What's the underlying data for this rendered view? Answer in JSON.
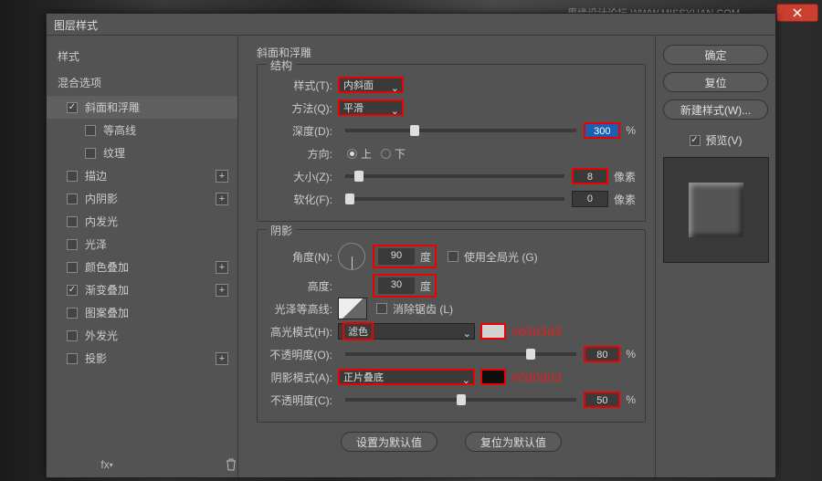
{
  "watermark": "思缘设计论坛  WWW.MISSYUAN.COM",
  "dialog_title": "图层样式",
  "sidebar": {
    "head1": "样式",
    "head2": "混合选项",
    "items": [
      {
        "label": "斜面和浮雕",
        "checked": true,
        "selected": true,
        "plus": false,
        "child": false
      },
      {
        "label": "等高线",
        "checked": false,
        "plus": false,
        "child": true
      },
      {
        "label": "纹理",
        "checked": false,
        "plus": false,
        "child": true
      },
      {
        "label": "描边",
        "checked": false,
        "plus": true,
        "child": false
      },
      {
        "label": "内阴影",
        "checked": false,
        "plus": true,
        "child": false
      },
      {
        "label": "内发光",
        "checked": false,
        "plus": false,
        "child": false
      },
      {
        "label": "光泽",
        "checked": false,
        "plus": false,
        "child": false
      },
      {
        "label": "颜色叠加",
        "checked": false,
        "plus": true,
        "child": false
      },
      {
        "label": "渐变叠加",
        "checked": true,
        "plus": true,
        "child": false
      },
      {
        "label": "图案叠加",
        "checked": false,
        "plus": false,
        "child": false
      },
      {
        "label": "外发光",
        "checked": false,
        "plus": false,
        "child": false
      },
      {
        "label": "投影",
        "checked": false,
        "plus": true,
        "child": false
      }
    ]
  },
  "main": {
    "title": "斜面和浮雕",
    "structure": {
      "legend": "结构",
      "style_label": "样式(T):",
      "style_value": "内斜面",
      "method_label": "方法(Q):",
      "method_value": "平滑",
      "depth_label": "深度(D):",
      "depth_value": "300",
      "depth_unit": "%",
      "dir_label": "方向:",
      "dir_up": "上",
      "dir_down": "下",
      "size_label": "大小(Z):",
      "size_value": "8",
      "size_unit": "像素",
      "soft_label": "软化(F):",
      "soft_value": "0",
      "soft_unit": "像素"
    },
    "shading": {
      "legend": "阴影",
      "angle_label": "角度(N):",
      "angle_value": "90",
      "angle_unit": "度",
      "global_label": "使用全局光 (G)",
      "alt_label": "高度:",
      "alt_value": "30",
      "alt_unit": "度",
      "gloss_label": "光泽等高线:",
      "aa_label": "消除锯齿 (L)",
      "hi_mode_label": "高光模式(H):",
      "hi_mode_value": "滤色",
      "hi_color": "#d3d3d3",
      "hi_color_text": "#d3d3d3",
      "hi_op_label": "不透明度(O):",
      "hi_op_value": "80",
      "hi_op_unit": "%",
      "sh_mode_label": "阴影模式(A):",
      "sh_mode_value": "正片叠底",
      "sh_color": "#0d0d0d",
      "sh_color_text": "#0d0d0d",
      "sh_op_label": "不透明度(C):",
      "sh_op_value": "50",
      "sh_op_unit": "%"
    },
    "defaults": {
      "set": "设置为默认值",
      "reset": "复位为默认值"
    }
  },
  "right": {
    "ok": "确定",
    "cancel": "复位",
    "new_style": "新建样式(W)...",
    "preview": "预览(V)"
  }
}
